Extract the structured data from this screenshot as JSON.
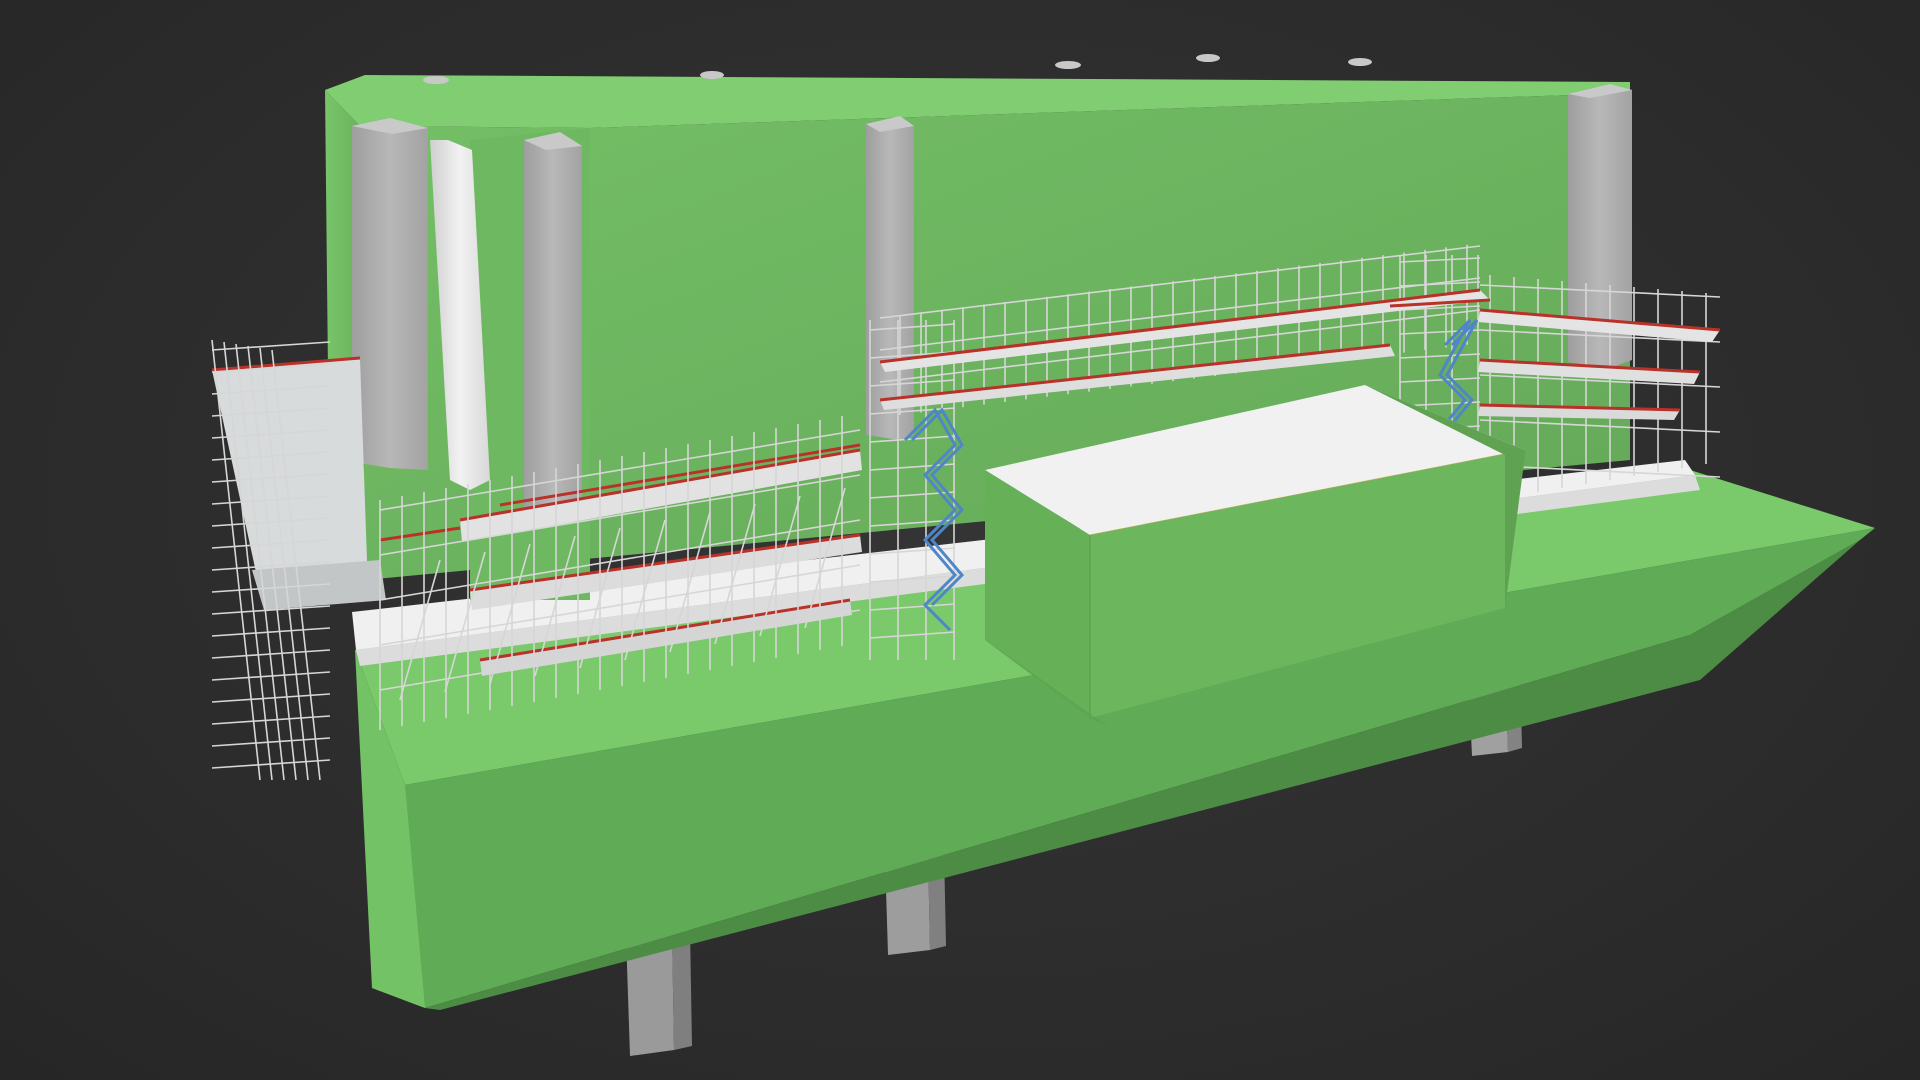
{
  "viewer": {
    "background_color": "#2e2e2e"
  },
  "model": {
    "colors": {
      "green_light": "#7dcb6e",
      "green_face": "#6cb45e",
      "green_dark": "#4e8c45",
      "green_shadow": "#3f7638",
      "concrete": "#a9a9a9",
      "concrete_light": "#d0d0d0",
      "deck_white": "#eeeeee",
      "scaffold_tube": "#d8d8d8",
      "toe_board": "#b8322a",
      "stair": "#4f86c8"
    },
    "components": [
      "building",
      "base-slab",
      "support-piers",
      "front-block",
      "scaffolding",
      "stair-towers"
    ]
  }
}
